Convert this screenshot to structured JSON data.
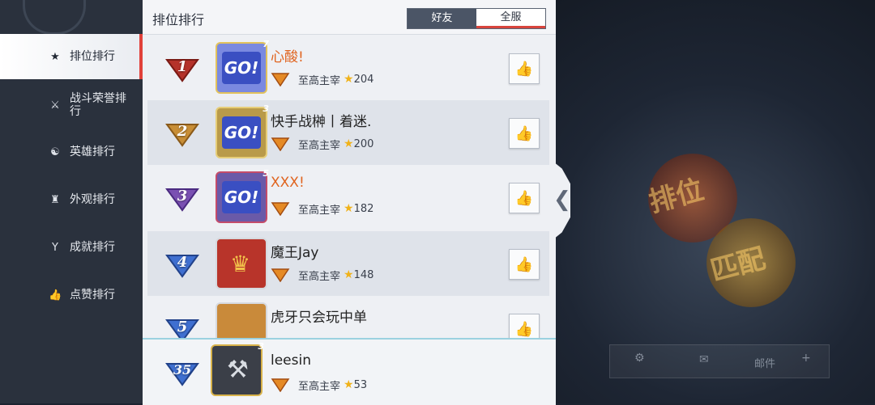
{
  "header": {
    "title": "排位排行",
    "tabs": [
      "好友",
      "全服"
    ]
  },
  "sidebar": {
    "items": [
      {
        "label": "排位排行",
        "icon": "star-icon",
        "glyph": "★",
        "active": true
      },
      {
        "label": "战斗荣誉排行",
        "icon": "crossed-swords-icon",
        "glyph": "⚔",
        "active": false
      },
      {
        "label": "英雄排行",
        "icon": "hero-icon",
        "glyph": "☯",
        "active": false
      },
      {
        "label": "外观排行",
        "icon": "shirt-icon",
        "glyph": "♜",
        "active": false
      },
      {
        "label": "成就排行",
        "icon": "trophy-icon",
        "glyph": "Y",
        "active": false
      },
      {
        "label": "点赞排行",
        "icon": "thumbs-up-icon",
        "glyph": "👍",
        "active": false
      }
    ]
  },
  "rankings": [
    {
      "rank": "1",
      "name": "心酸!",
      "level": "7",
      "tier": "至高主宰",
      "stars": "204",
      "name_color": "#e0641f",
      "rank_color": "#c0392b"
    },
    {
      "rank": "2",
      "name": "快手战榊丨着迷.",
      "level": "3",
      "tier": "至高主宰",
      "stars": "200",
      "name_color": "#222222",
      "rank_color": "#d49a3a"
    },
    {
      "rank": "3",
      "name": "XXX!",
      "level": "5",
      "tier": "至高主宰",
      "stars": "182",
      "name_color": "#e0641f",
      "rank_color": "#7a4fb0"
    },
    {
      "rank": "4",
      "name": "魔王Jay",
      "level": "",
      "tier": "至高主宰",
      "stars": "148",
      "name_color": "#222222",
      "rank_color": "#3f6fd0"
    },
    {
      "rank": "5",
      "name": "虎牙只会玩中单",
      "level": "",
      "tier": "",
      "stars": "",
      "name_color": "#222222",
      "rank_color": "#3f6fd0"
    }
  ],
  "my_rank": {
    "rank": "35",
    "name": "leesin",
    "level": "3",
    "tier": "至高主宰",
    "stars": "53"
  },
  "background": {
    "orb_labels": [
      "排位",
      "匹配"
    ],
    "bottom_bar": [
      "邮件"
    ]
  },
  "colors": {
    "accent": "#e1413a",
    "star": "#f0b21a",
    "orange_name": "#e0641f"
  }
}
